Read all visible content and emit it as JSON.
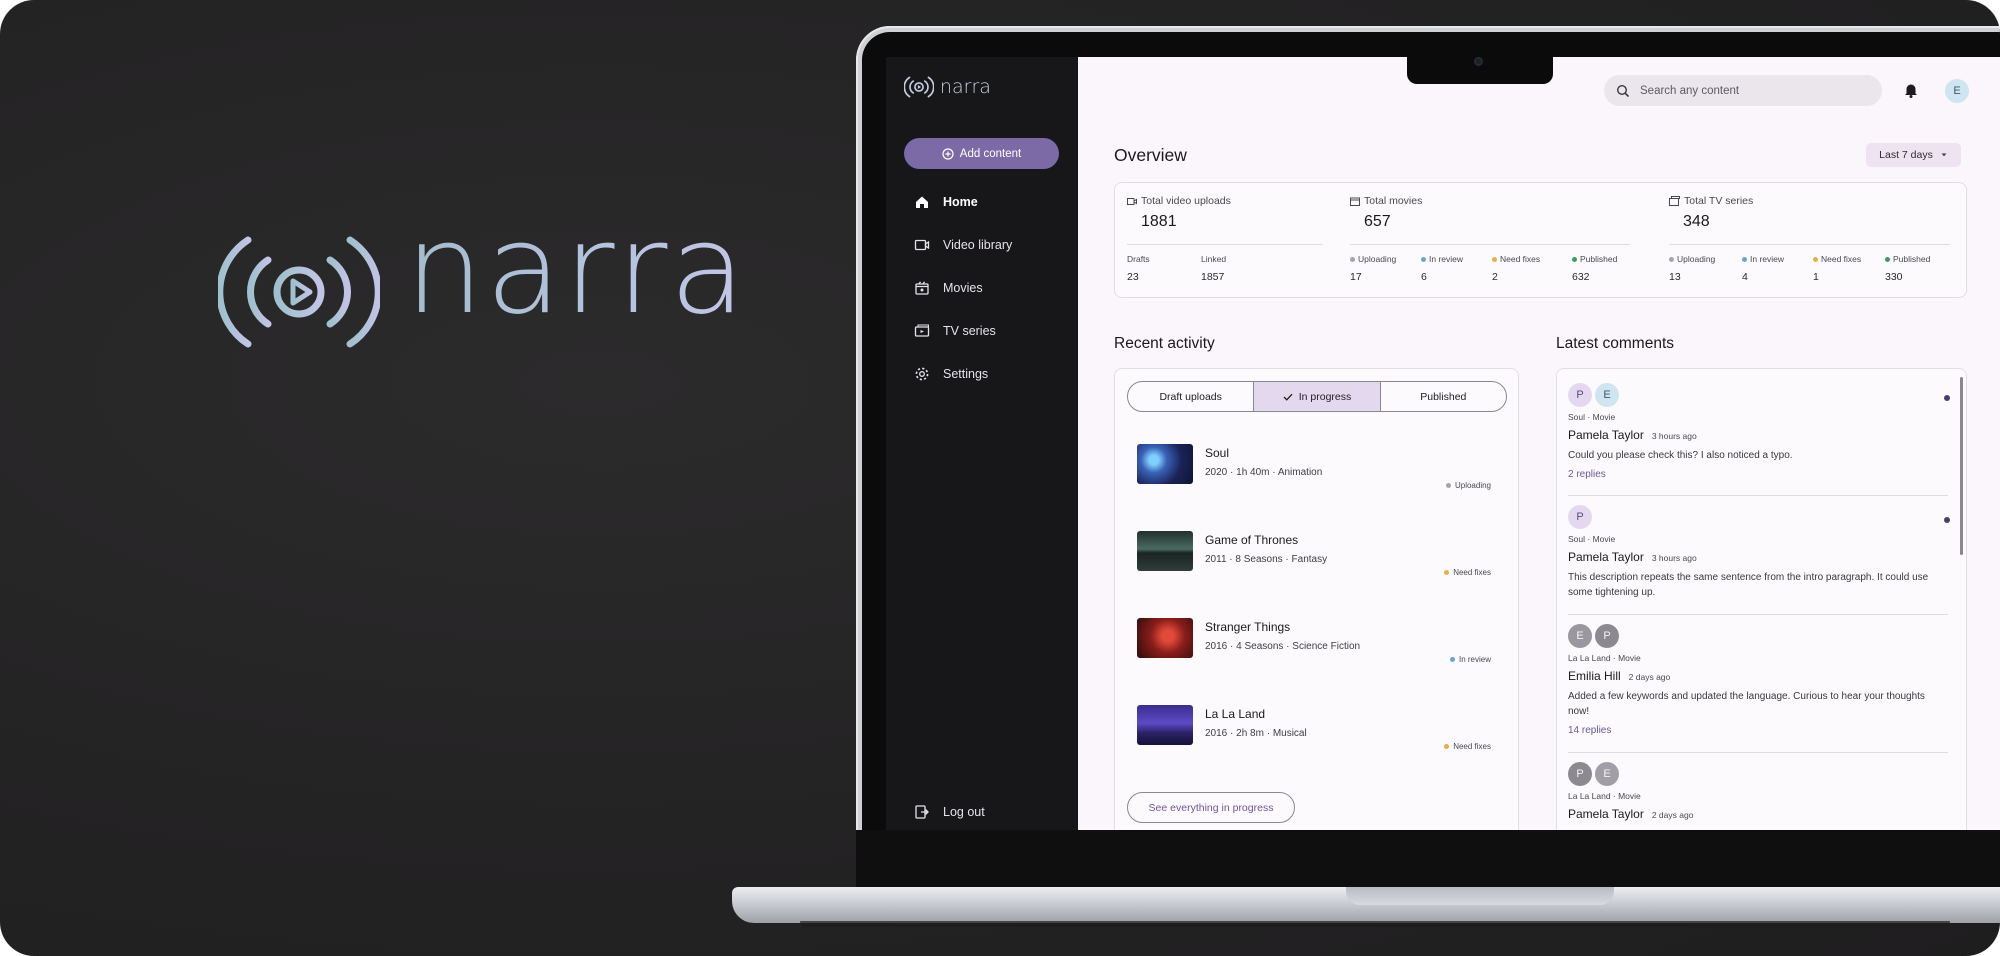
{
  "hero": {
    "word": "narra"
  },
  "app": {
    "brand": "narra",
    "add_button": "Add content",
    "nav": [
      {
        "label": "Home",
        "icon": "home-icon"
      },
      {
        "label": "Video library",
        "icon": "video-icon"
      },
      {
        "label": "Movies",
        "icon": "movie-icon"
      },
      {
        "label": "TV series",
        "icon": "tv-icon"
      },
      {
        "label": "Settings",
        "icon": "gear-icon"
      }
    ],
    "logout": "Log out",
    "search_placeholder": "Search any content",
    "user_initial": "E",
    "overview": {
      "title": "Overview",
      "range": "Last 7 days",
      "stats": [
        {
          "label": "Total video uploads",
          "value": "1881",
          "subs": [
            {
              "label": "Drafts",
              "value": "23"
            },
            {
              "label": "Linked",
              "value": "1857"
            }
          ]
        },
        {
          "label": "Total movies",
          "value": "657",
          "subs": [
            {
              "label": "Uploading",
              "value": "17"
            },
            {
              "label": "In review",
              "value": "6"
            },
            {
              "label": "Need fixes",
              "value": "2"
            },
            {
              "label": "Published",
              "value": "632"
            }
          ]
        },
        {
          "label": "Total TV series",
          "value": "348",
          "subs": [
            {
              "label": "Uploading",
              "value": "13"
            },
            {
              "label": "In review",
              "value": "4"
            },
            {
              "label": "Need fixes",
              "value": "1"
            },
            {
              "label": "Published",
              "value": "330"
            }
          ]
        }
      ]
    },
    "status_colors": {
      "Uploading": "#a7a3ab",
      "In review": "#6aa6c9",
      "Need fixes": "#e4b04a",
      "Published": "#3c9b63"
    },
    "recent": {
      "title": "Recent activity",
      "tabs": [
        "Draft uploads",
        "In progress",
        "Published"
      ],
      "items": [
        {
          "title": "Soul",
          "meta": "2020 · 1h 40m · Animation",
          "status": "Uploading"
        },
        {
          "title": "Game of Thrones",
          "meta": "2011 · 8 Seasons · Fantasy",
          "status": "Need fixes"
        },
        {
          "title": "Stranger Things",
          "meta": "2016 · 4 Seasons · Science Fiction",
          "status": "In review"
        },
        {
          "title": "La La Land",
          "meta": "2016 · 2h 8m · Musical",
          "status": "Need fixes"
        }
      ],
      "see_all": "See everything in progress"
    },
    "comments": {
      "title": "Latest comments",
      "items": [
        {
          "avatars": [
            "P",
            "E"
          ],
          "meta": "Soul · Movie",
          "author": "Pamela Taylor",
          "time": "3 hours ago",
          "text": "Could you please check this? I also noticed a typo.",
          "replies": "2 replies"
        },
        {
          "avatars": [
            "P"
          ],
          "meta": "Soul · Movie",
          "author": "Pamela Taylor",
          "time": "3 hours ago",
          "text": "This description repeats the same sentence from the intro paragraph. It could use some tightening up.",
          "replies": ""
        },
        {
          "avatars": [
            "E",
            "P"
          ],
          "meta": "La La Land · Movie",
          "author": "Emilia Hill",
          "time": "2 days ago",
          "text": "Added a few keywords and updated the language. Curious to hear your thoughts now!",
          "replies": "14 replies"
        },
        {
          "avatars": [
            "P",
            "E"
          ],
          "meta": "La La Land · Movie",
          "author": "Pamela Taylor",
          "time": "2 days ago",
          "text": "",
          "replies": ""
        }
      ]
    }
  }
}
